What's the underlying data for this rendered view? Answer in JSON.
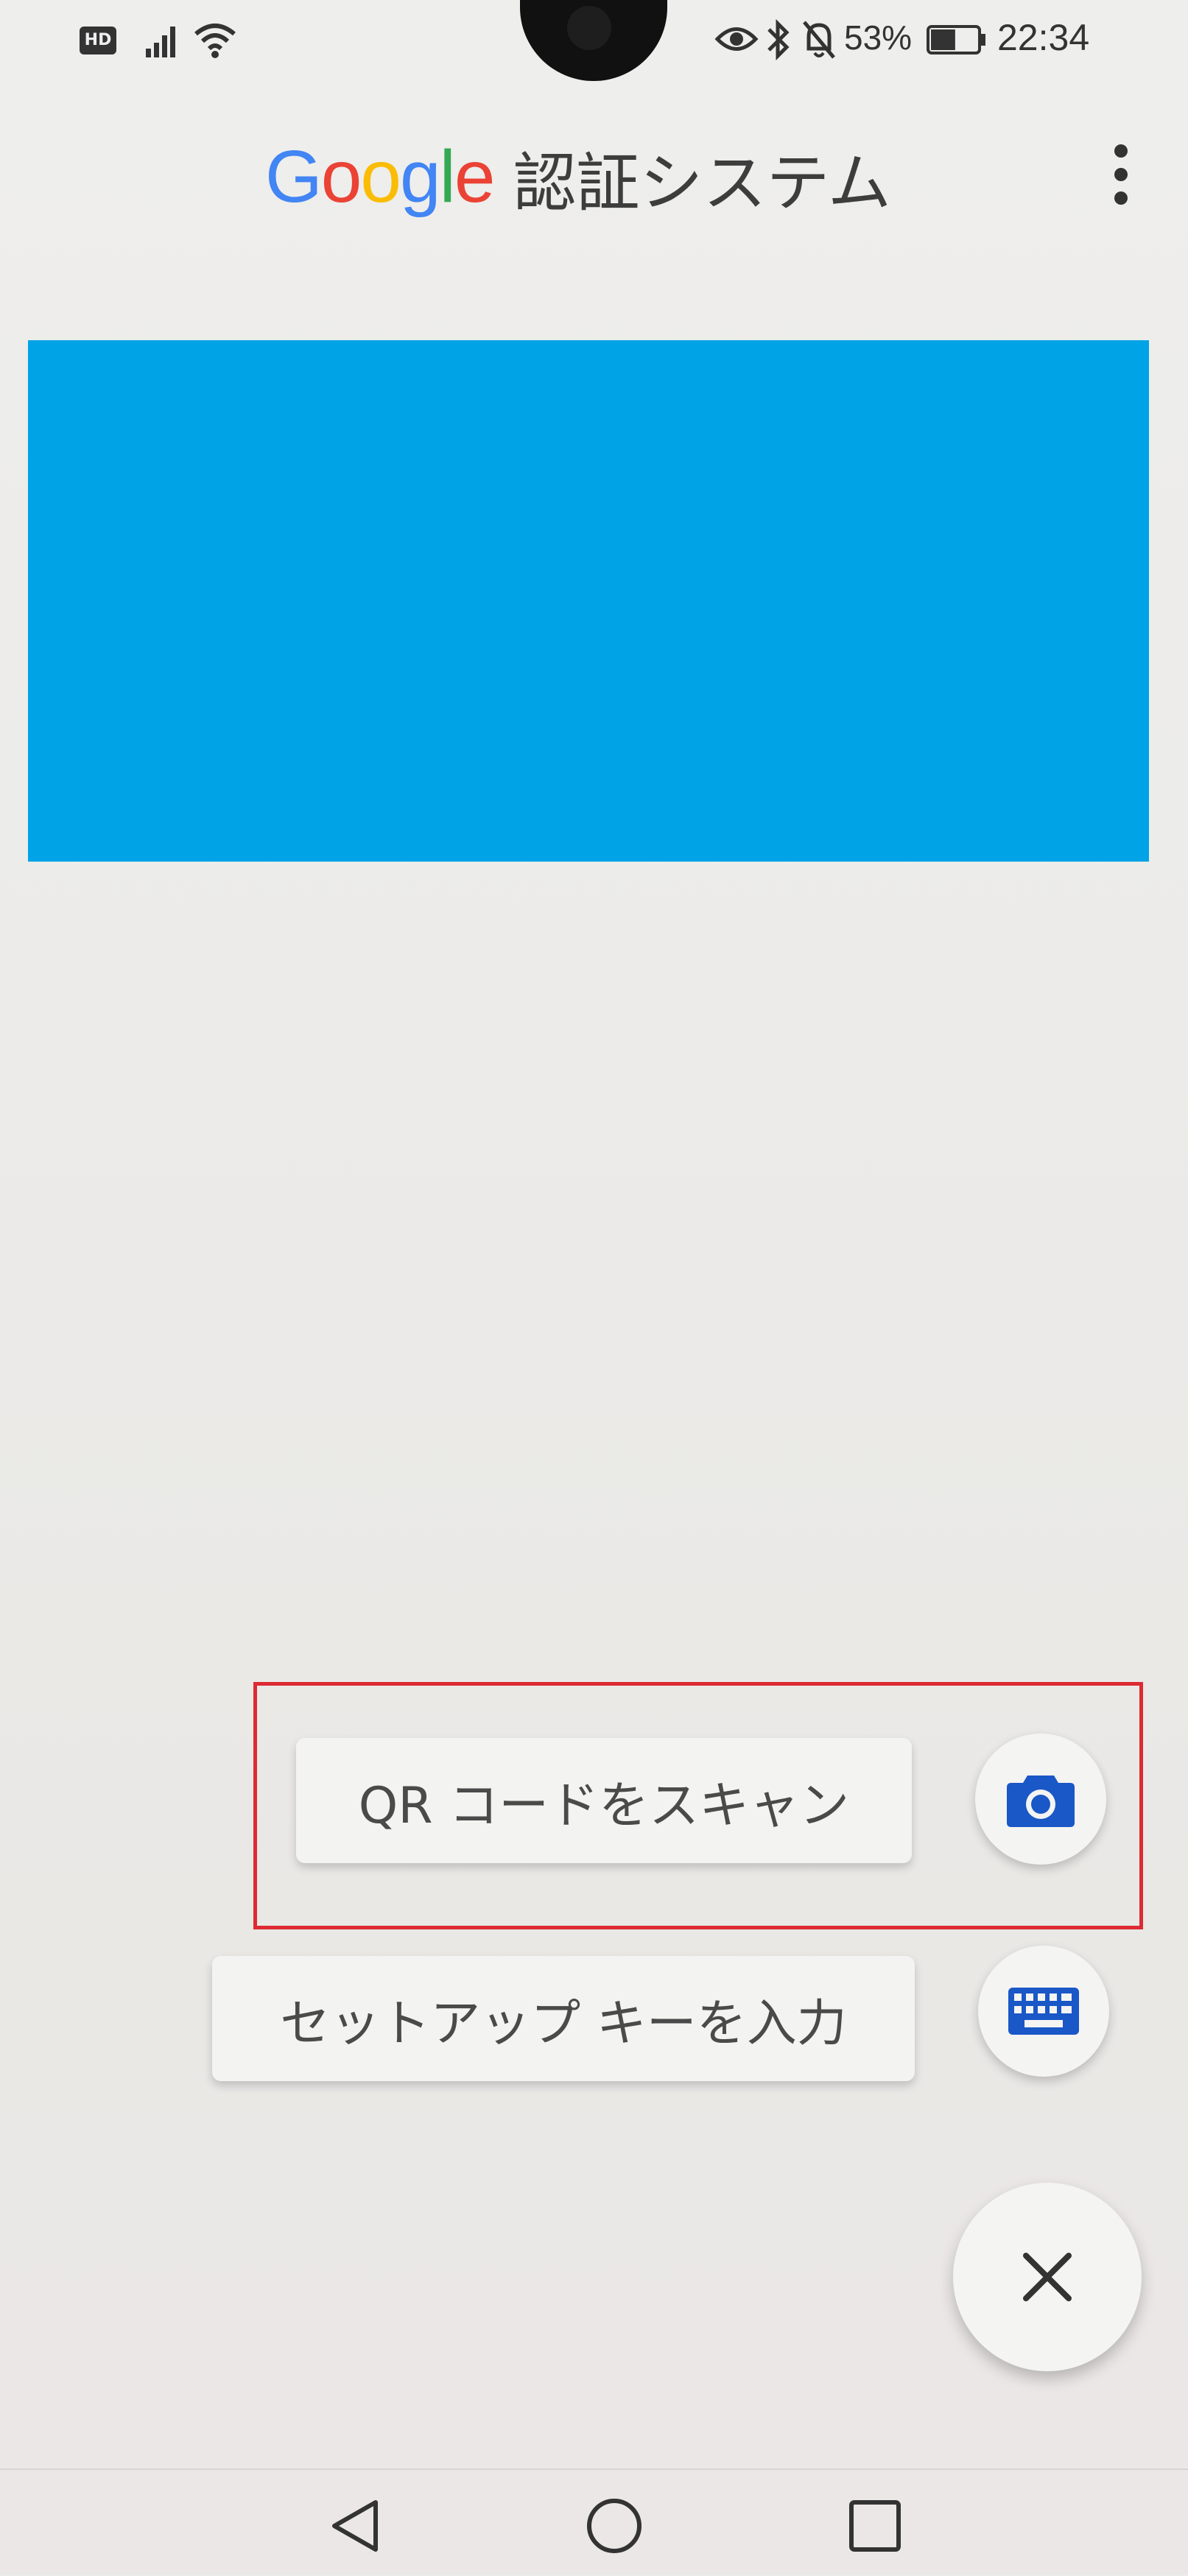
{
  "status_bar": {
    "network_badge": "HD",
    "icons": [
      "signal-icon",
      "wifi-icon",
      "eye-icon",
      "bluetooth-icon",
      "bell-off-icon",
      "battery-icon"
    ],
    "battery_percent": "53%",
    "battery_level": 0.53,
    "time": "22:34"
  },
  "header": {
    "logo_text": "Google",
    "title": "認証システム",
    "menu_icon": "more-vert-icon"
  },
  "redacted": {
    "color": "#00a3e6"
  },
  "speed_dial": {
    "scan_qr_label": "QR コードをスキャン",
    "enter_key_label": "セットアップ キーを入力",
    "scan_icon": "camera-icon",
    "key_icon": "keyboard-icon",
    "close_icon": "close-icon"
  },
  "highlight": {
    "color": "#dd2a33"
  },
  "nav_bar": {
    "icons": [
      "back-icon",
      "home-icon",
      "recents-icon"
    ]
  },
  "colors": {
    "accent_blue": "#1a57c7",
    "google_blue": "#4285f4",
    "google_red": "#ea4335",
    "google_yellow": "#fbbc05",
    "google_green": "#34a853"
  }
}
